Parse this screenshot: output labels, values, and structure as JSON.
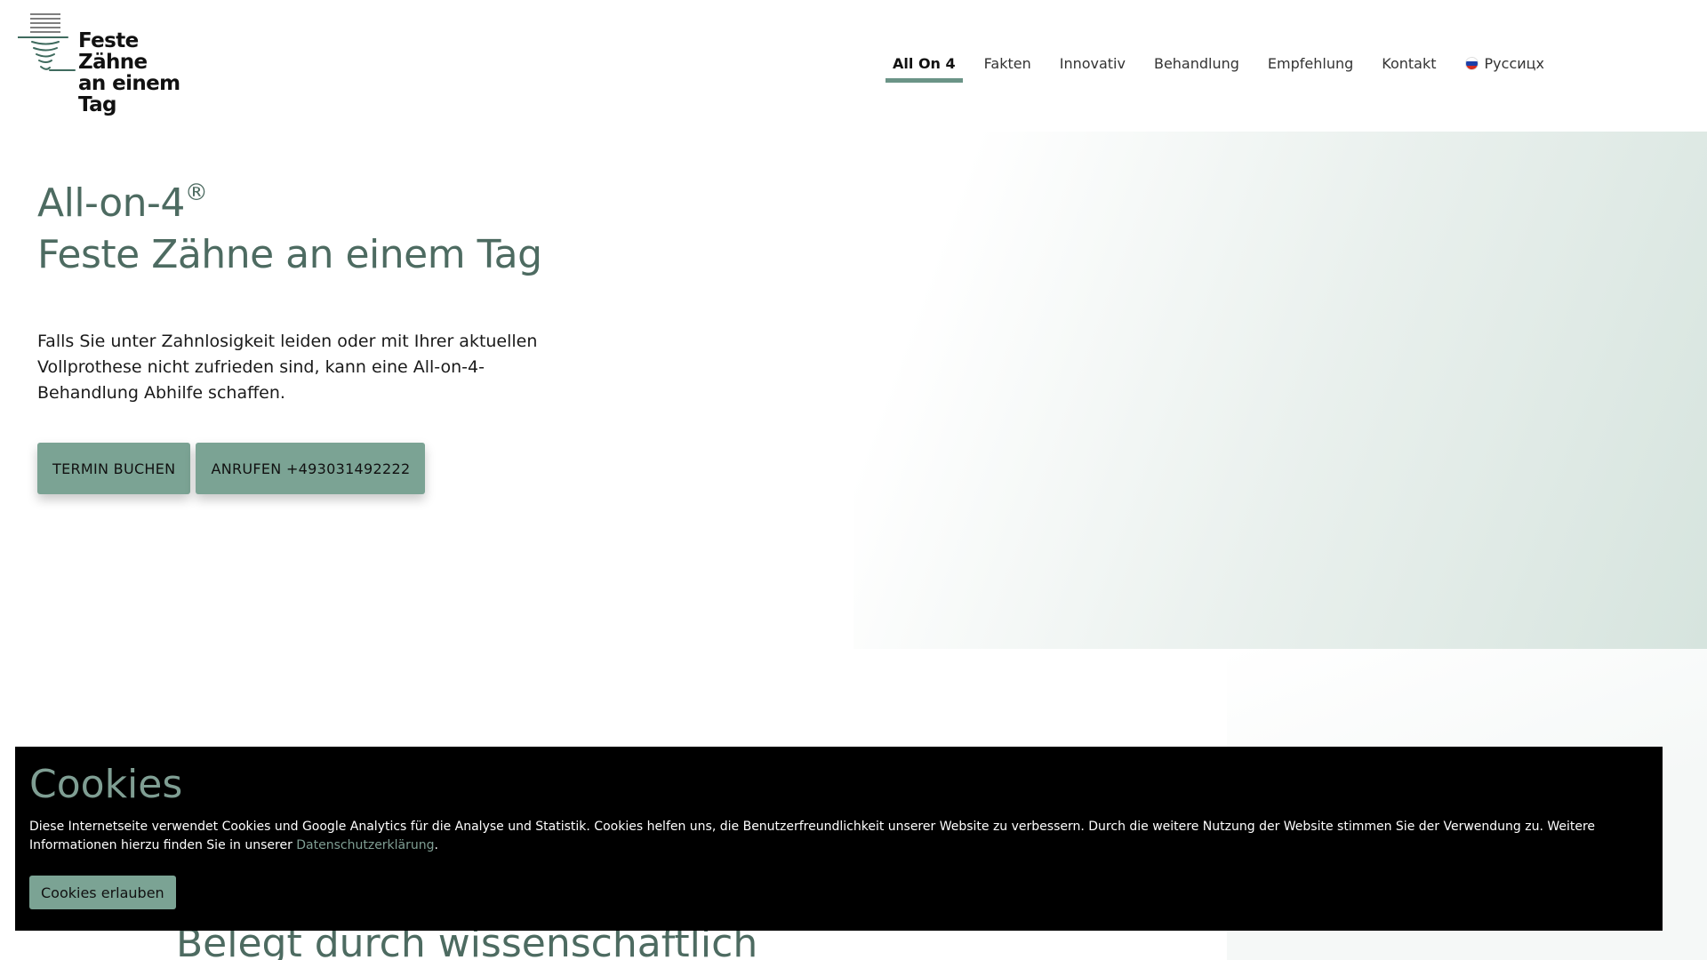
{
  "logo": {
    "lines": [
      "Feste",
      "Zähne",
      "an einem",
      "Tag"
    ]
  },
  "nav": {
    "items": [
      {
        "label": "All On 4",
        "active": true
      },
      {
        "label": "Fakten"
      },
      {
        "label": "Innovativ"
      },
      {
        "label": "Behandlung"
      },
      {
        "label": "Empfehlung"
      },
      {
        "label": "Kontakt"
      }
    ],
    "language": {
      "label": "Руссицх",
      "icon": "russian-flag-icon"
    }
  },
  "hero": {
    "title_line1": "All-on-4",
    "title_reg": "®",
    "title_line2": "Feste Zähne an einem Tag",
    "text": "Falls Sie unter Zahnlosigkeit leiden oder mit Ihrer aktuellen Vollprothese nicht zufrieden sind, kann eine All-on-4-Behandlung Abhilfe schaffen.",
    "buttons": {
      "book": "TERMIN BUCHEN",
      "call": "ANRUFEN +493031492222"
    }
  },
  "section": {
    "title": "Belegt durch wissenschaftlich"
  },
  "cookie": {
    "title": "Cookies",
    "text": "Diese Internetseite verwendet Cookies und Google Analytics für die Analyse und Statistik. Cookies helfen uns, die Benutzerfreundlichkeit unserer Website zu verbessern. Durch die weitere Nutzung der Website stimmen Sie der Verwendung zu. Weitere Informationen hierzu finden Sie in unserer ",
    "link": "Datenschutzerklärung",
    "text_end": ".",
    "button": "Cookies erlauben"
  },
  "colors": {
    "accent": "#7ba394",
    "heading": "#4d6b61",
    "cookie_bg": "#000000"
  }
}
